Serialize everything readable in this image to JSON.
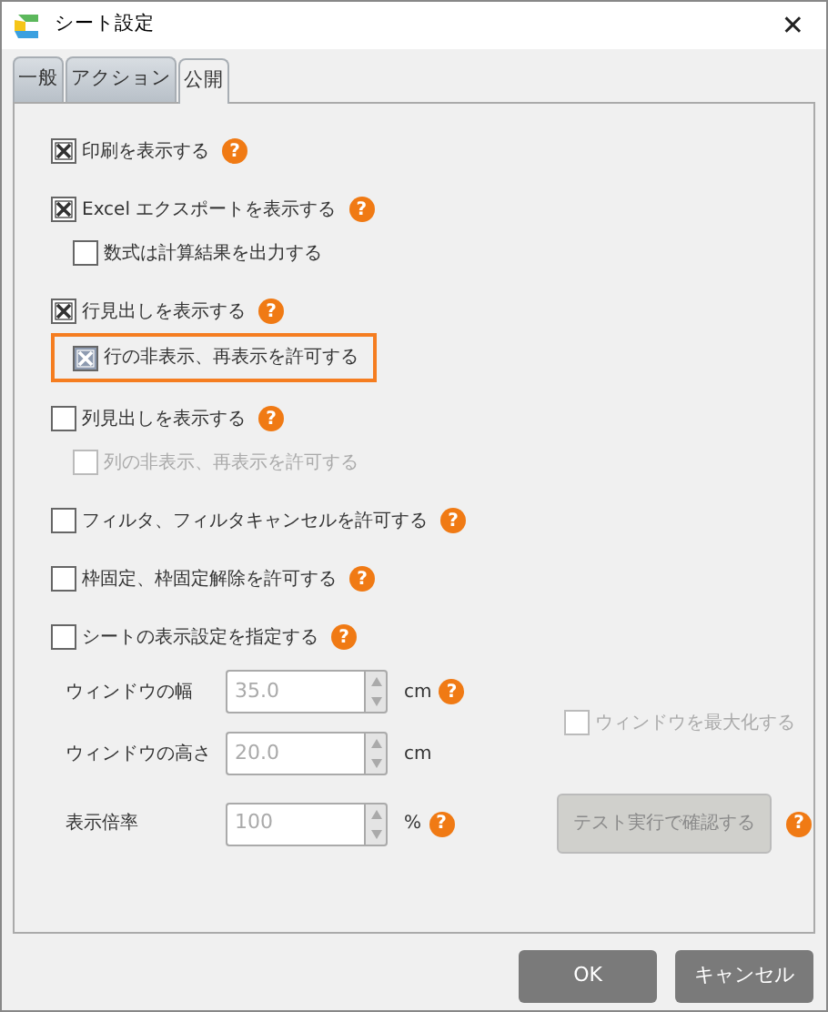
{
  "window": {
    "title": "シート設定",
    "close": "✕"
  },
  "tabs": [
    {
      "label": "一般",
      "selected": false
    },
    {
      "label": "アクション",
      "selected": false
    },
    {
      "label": "公開",
      "selected": true
    }
  ],
  "options": [
    {
      "label": "印刷を表示する",
      "checked": true,
      "disabled": false,
      "highlighted": false,
      "help": "?"
    },
    {
      "label": "Excel エクスポートを表示する",
      "checked": true,
      "disabled": false,
      "highlighted": false,
      "help": "?",
      "children": [
        {
          "label": "数式は計算結果を出力する",
          "checked": false,
          "disabled": false,
          "highlighted": false
        }
      ]
    },
    {
      "label": "行見出しを表示する",
      "checked": true,
      "disabled": false,
      "highlighted": false,
      "help": "?",
      "children": [
        {
          "label": "行の非表示、再表示を許可する",
          "checked": true,
          "disabled": false,
          "highlighted": true
        }
      ]
    },
    {
      "label": "列見出しを表示する",
      "checked": false,
      "disabled": false,
      "highlighted": false,
      "help": "?",
      "children": [
        {
          "label": "列の非表示、再表示を許可する",
          "checked": false,
          "disabled": true,
          "highlighted": false
        }
      ]
    },
    {
      "label": "フィルタ、フィルタキャンセルを許可する",
      "checked": false,
      "disabled": false,
      "highlighted": false,
      "help": "?"
    },
    {
      "label": "枠固定、枠固定解除を許可する",
      "checked": false,
      "disabled": false,
      "highlighted": false,
      "help": "?"
    },
    {
      "label": "シートの表示設定を指定する",
      "checked": false,
      "disabled": false,
      "highlighted": false,
      "help": "?"
    }
  ],
  "view_fields": [
    {
      "label": "ウィンドウの幅",
      "value": "35.0",
      "unit": "cm",
      "help": "?"
    },
    {
      "label": "ウィンドウの高さ",
      "value": "20.0",
      "unit": "cm"
    },
    {
      "label": "表示倍率",
      "value": "100",
      "unit": "%",
      "help": "?"
    }
  ],
  "maximize": {
    "label": "ウィンドウを最大化する",
    "checked": false,
    "disabled": true
  },
  "test_button": {
    "label": "テスト実行で確認する",
    "disabled": true,
    "help": "?"
  },
  "buttons": [
    {
      "label": "OK"
    },
    {
      "label": "キャンセル"
    }
  ]
}
